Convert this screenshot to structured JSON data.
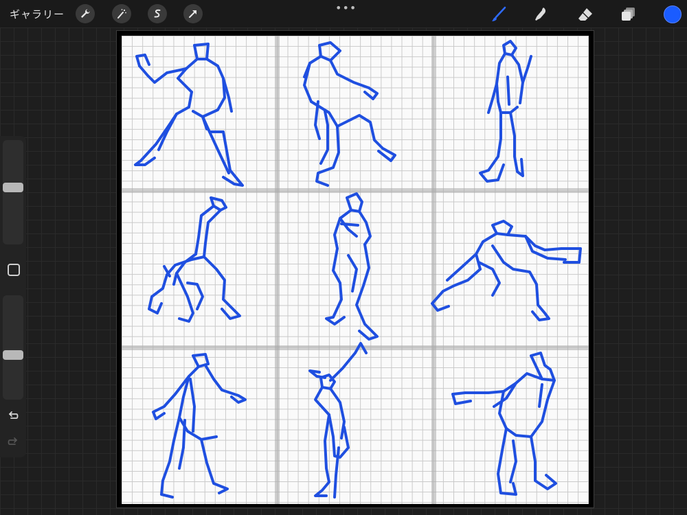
{
  "topbar": {
    "gallery_label": "ギャラリー",
    "left_tools": [
      "wrench-icon",
      "magic-wand-icon",
      "selection-icon",
      "transform-arrow-icon"
    ],
    "right_tools": [
      "brush-icon",
      "smudge-icon",
      "eraser-icon",
      "layers-icon"
    ]
  },
  "colors": {
    "stroke": "#1f4fe0",
    "active_color": "#1a5cff",
    "brush_active": "#2f6bff"
  },
  "sidebar": {
    "size_slider_level": 0.55,
    "opacity_slider_level": 0.42
  }
}
